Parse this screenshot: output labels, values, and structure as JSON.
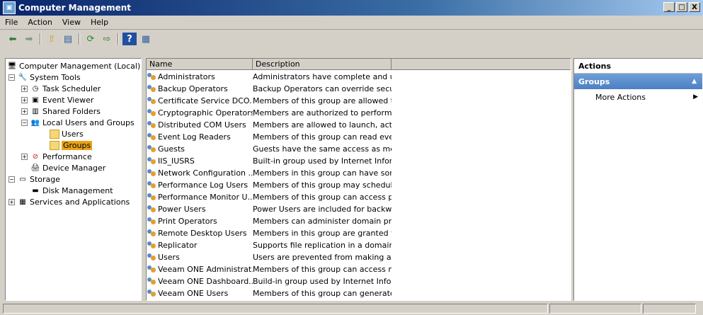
{
  "window": {
    "title": "Computer Management",
    "buttons": [
      "_",
      "□",
      "X"
    ]
  },
  "menu": [
    "File",
    "Action",
    "View",
    "Help"
  ],
  "toolbar": {
    "icons": [
      "back-arrow-icon",
      "forward-arrow-icon",
      "up-folder-icon",
      "show-tree-icon",
      "refresh-icon",
      "export-icon",
      "help-icon",
      "properties-icon"
    ]
  },
  "tree": [
    {
      "label": "Computer Management (Local)",
      "level": 0,
      "expander": "",
      "icon": "computer-management-icon"
    },
    {
      "label": "System Tools",
      "level": 1,
      "expander": "−",
      "icon": "system-tools-icon"
    },
    {
      "label": "Task Scheduler",
      "level": 2,
      "expander": "+",
      "icon": "task-scheduler-icon"
    },
    {
      "label": "Event Viewer",
      "level": 2,
      "expander": "+",
      "icon": "event-viewer-icon"
    },
    {
      "label": "Shared Folders",
      "level": 2,
      "expander": "+",
      "icon": "shared-folders-icon"
    },
    {
      "label": "Local Users and Groups",
      "level": 2,
      "expander": "−",
      "icon": "users-groups-icon"
    },
    {
      "label": "Users",
      "level": 3,
      "expander": "",
      "icon": "folder-icon"
    },
    {
      "label": "Groups",
      "level": 3,
      "expander": "",
      "icon": "folder-icon",
      "selected": true
    },
    {
      "label": "Performance",
      "level": 2,
      "expander": "+",
      "icon": "performance-icon"
    },
    {
      "label": "Device Manager",
      "level": 2,
      "expander": "",
      "icon": "device-manager-icon"
    },
    {
      "label": "Storage",
      "level": 1,
      "expander": "−",
      "icon": "storage-icon"
    },
    {
      "label": "Disk Management",
      "level": 2,
      "expander": "",
      "icon": "disk-management-icon"
    },
    {
      "label": "Services and Applications",
      "level": 1,
      "expander": "+",
      "icon": "services-icon"
    }
  ],
  "list": {
    "columns": [
      "Name",
      "Description"
    ],
    "rows": [
      {
        "name": "Administrators",
        "description": "Administrators have complete and u..."
      },
      {
        "name": "Backup Operators",
        "description": "Backup Operators can override secu..."
      },
      {
        "name": "Certificate Service DCO...",
        "description": "Members of this group are allowed t..."
      },
      {
        "name": "Cryptographic Operators",
        "description": "Members are authorized to perform ..."
      },
      {
        "name": "Distributed COM Users",
        "description": "Members are allowed to launch, acti..."
      },
      {
        "name": "Event Log Readers",
        "description": "Members of this group can read eve..."
      },
      {
        "name": "Guests",
        "description": "Guests have the same access as me..."
      },
      {
        "name": "IIS_IUSRS",
        "description": "Built-in group used by Internet Infor..."
      },
      {
        "name": "Network Configuration ...",
        "description": "Members in this group can have som..."
      },
      {
        "name": "Performance Log Users",
        "description": "Members of this group may schedule..."
      },
      {
        "name": "Performance Monitor U...",
        "description": "Members of this group can access p..."
      },
      {
        "name": "Power Users",
        "description": "Power Users are included for backw..."
      },
      {
        "name": "Print Operators",
        "description": "Members can administer domain prin..."
      },
      {
        "name": "Remote Desktop Users",
        "description": "Members in this group are granted t..."
      },
      {
        "name": "Replicator",
        "description": "Supports file replication in a domain"
      },
      {
        "name": "Users",
        "description": "Users are prevented from making ac..."
      },
      {
        "name": "Veeam ONE Administrat...",
        "description": "Members of this group can access m..."
      },
      {
        "name": "Veeam ONE Dashboard...",
        "description": "Build-in group used by Internet Infor..."
      },
      {
        "name": "Veeam ONE Users",
        "description": "Members of this group can generate..."
      }
    ]
  },
  "actions": {
    "header": "Actions",
    "section": "Groups",
    "items": [
      {
        "label": "More Actions"
      }
    ]
  }
}
